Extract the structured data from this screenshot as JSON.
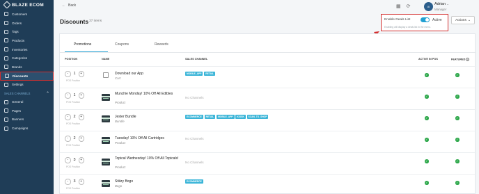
{
  "brand": {
    "name": "BLAZE ECOM"
  },
  "sidebar": {
    "items": [
      {
        "label": "Customers",
        "icon": "users-icon"
      },
      {
        "label": "Orders",
        "icon": "cart-icon"
      },
      {
        "label": "Tags",
        "icon": "tag-icon"
      },
      {
        "label": "Products",
        "icon": "box-icon"
      },
      {
        "label": "Inventories",
        "icon": "inventory-icon"
      },
      {
        "label": "Categories",
        "icon": "categories-icon"
      },
      {
        "label": "Brands",
        "icon": "brand-icon"
      },
      {
        "label": "Discounts",
        "icon": "discount-icon",
        "active": true
      },
      {
        "label": "Settings",
        "icon": "gear-icon"
      }
    ],
    "section_label": "SALES CHANNELS",
    "section_items": [
      {
        "label": "General",
        "icon": "globe-icon"
      },
      {
        "label": "Pages",
        "icon": "page-icon"
      },
      {
        "label": "Banners",
        "icon": "banner-icon"
      },
      {
        "label": "Campaigns",
        "icon": "campaign-icon"
      }
    ]
  },
  "header": {
    "back_label": "Back",
    "user": {
      "initials": "AI",
      "name": "Adrian",
      "role": "Manager"
    }
  },
  "page": {
    "title": "Discounts",
    "count": "37 items"
  },
  "deals": {
    "label": "Enable Deals List",
    "toggle_state": "Active",
    "help": "Enabling will display a deals list in the menu."
  },
  "actions_label": "Actions",
  "tabs": [
    "Promotions",
    "Coupons",
    "Rewards"
  ],
  "columns": {
    "position": "POSITION",
    "name": "NAME",
    "sales_channel": "SALES CHANNEL",
    "active_in_pos": "ACTIVE IN POS",
    "featured": "FEATURED"
  },
  "pos_label": "POS Position",
  "no_channels": "No Channels",
  "colors": {
    "accent": "#21a0d2",
    "sidebar": "#1f3d57",
    "check": "#2ea84b",
    "highlight": "#d32f2f"
  },
  "rows": [
    {
      "position": "1",
      "name": "Download our App",
      "type": "Cart",
      "channels": [
        "MOBILE_APP",
        "RETAIL"
      ],
      "active_in_pos": true,
      "featured": true,
      "thumb": "plain"
    },
    {
      "position": "1",
      "name": "Munchie Monday! 10% Off All Edibles",
      "type": "Product",
      "channels": [],
      "active_in_pos": true,
      "featured": true,
      "thumb": "image"
    },
    {
      "position": "2",
      "name": "Jester Bundle",
      "type": "Bundle",
      "channels": [
        "ECOMMERCE",
        "RETAIL",
        "MOBILE_APP",
        "KIOSK",
        "SCAN_TO_SHOP"
      ],
      "active_in_pos": true,
      "featured": true,
      "thumb": "image"
    },
    {
      "position": "2",
      "name": "Tuesday! 10% Off All Cartridges",
      "type": "Product",
      "channels": [],
      "active_in_pos": true,
      "featured": true,
      "thumb": "image"
    },
    {
      "position": "3",
      "name": "Topical Wednesday! 10% Off All Topicals!",
      "type": "Product",
      "channels": [],
      "active_in_pos": true,
      "featured": true,
      "thumb": "image"
    },
    {
      "position": "3",
      "name": "Stiiizy Bogo",
      "type": "Bogo",
      "channels": [
        "ECOMMERCE"
      ],
      "active_in_pos": true,
      "featured": true,
      "thumb": "image"
    }
  ]
}
